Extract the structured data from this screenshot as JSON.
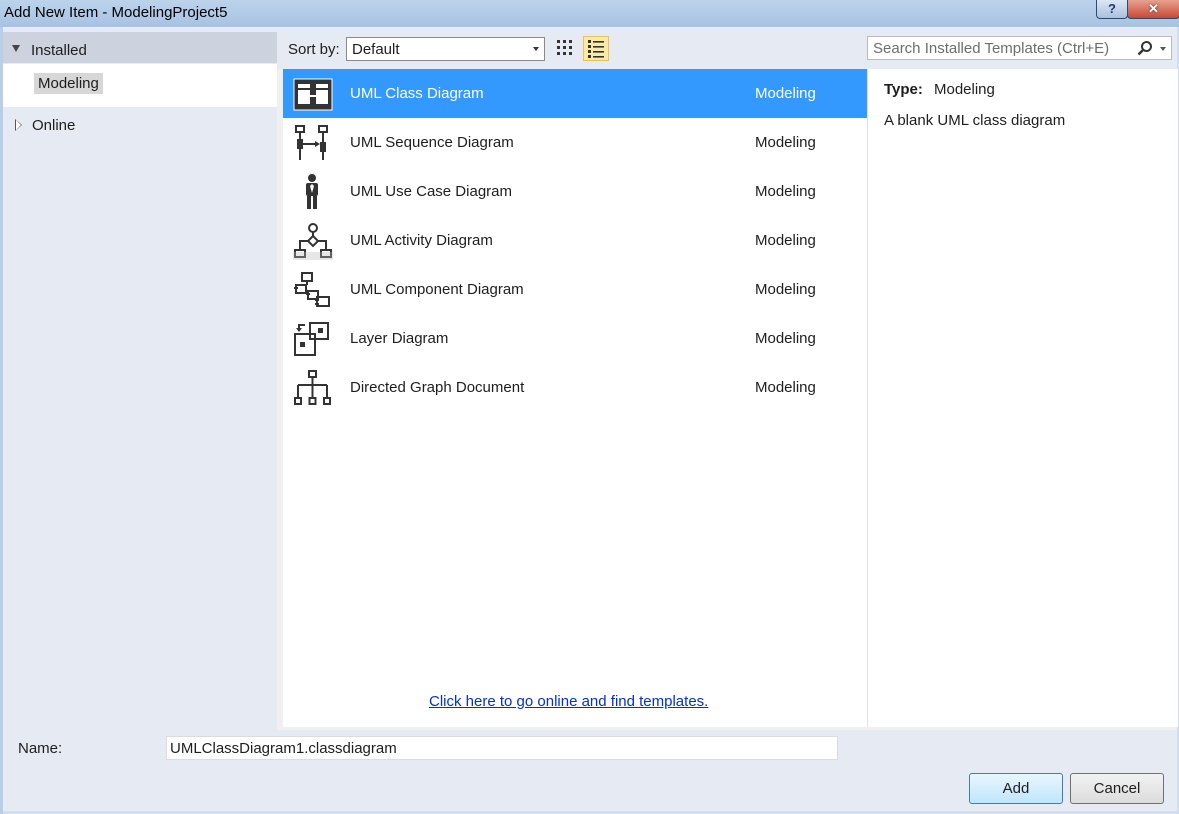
{
  "window": {
    "title": "Add New Item - ModelingProject5",
    "help_label": "?",
    "close_label": "✕"
  },
  "left_tree": {
    "installed_label": "Installed",
    "modeling_label": "Modeling",
    "online_label": "Online"
  },
  "toolbar": {
    "sort_by_label": "Sort by:",
    "sort_value": "Default"
  },
  "search": {
    "placeholder": "Search Installed Templates (Ctrl+E)"
  },
  "templates": [
    {
      "name": "UML Class Diagram",
      "category": "Modeling",
      "icon": "uml-class-diagram-icon",
      "selected": true
    },
    {
      "name": "UML Sequence Diagram",
      "category": "Modeling",
      "icon": "uml-sequence-diagram-icon",
      "selected": false
    },
    {
      "name": "UML Use Case Diagram",
      "category": "Modeling",
      "icon": "uml-use-case-diagram-icon",
      "selected": false
    },
    {
      "name": "UML Activity Diagram",
      "category": "Modeling",
      "icon": "uml-activity-diagram-icon",
      "selected": false
    },
    {
      "name": "UML Component Diagram",
      "category": "Modeling",
      "icon": "uml-component-diagram-icon",
      "selected": false
    },
    {
      "name": "Layer Diagram",
      "category": "Modeling",
      "icon": "layer-diagram-icon",
      "selected": false
    },
    {
      "name": "Directed Graph Document",
      "category": "Modeling",
      "icon": "directed-graph-icon",
      "selected": false
    }
  ],
  "online_link": "Click here to go online and find templates.",
  "details": {
    "type_label": "Type:",
    "type_value": "Modeling",
    "description": "A blank UML class diagram"
  },
  "footer": {
    "name_label": "Name:",
    "name_value": "UMLClassDiagram1.classdiagram",
    "add_label": "Add",
    "cancel_label": "Cancel"
  },
  "colors": {
    "selection": "#3399ff",
    "link": "#0033cc",
    "panel": "#e6ebf3"
  }
}
